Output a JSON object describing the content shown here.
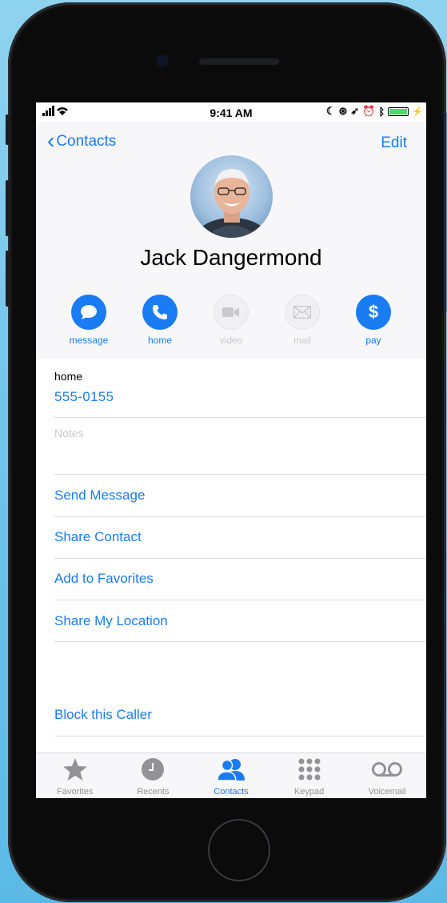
{
  "status_bar": {
    "time": "9:41 AM"
  },
  "nav": {
    "back_label": "Contacts",
    "edit_label": "Edit"
  },
  "contact": {
    "name": "Jack Dangermond"
  },
  "actions": [
    {
      "label": "message",
      "icon": "message-bubble-icon",
      "enabled": true
    },
    {
      "label": "home",
      "icon": "phone-icon",
      "enabled": true
    },
    {
      "label": "video",
      "icon": "video-camera-icon",
      "enabled": false
    },
    {
      "label": "mail",
      "icon": "envelope-icon",
      "enabled": false
    },
    {
      "label": "pay",
      "icon": "dollar-icon",
      "enabled": true
    }
  ],
  "phone": {
    "label": "home",
    "number": "555-0155"
  },
  "notes": {
    "placeholder": "Notes"
  },
  "links": {
    "send_message": "Send Message",
    "share_contact": "Share Contact",
    "add_to_favorites": "Add to Favorites",
    "share_location": "Share My Location",
    "block_caller": "Block this Caller"
  },
  "tabs": [
    {
      "label": "Favorites",
      "icon": "star-icon",
      "active": false
    },
    {
      "label": "Recents",
      "icon": "clock-icon",
      "active": false
    },
    {
      "label": "Contacts",
      "icon": "contacts-icon",
      "active": true
    },
    {
      "label": "Keypad",
      "icon": "keypad-icon",
      "active": false
    },
    {
      "label": "Voicemail",
      "icon": "voicemail-icon",
      "active": false
    }
  ],
  "colors": {
    "accent": "#1a7cf3",
    "background": "#6fc4ea",
    "triangle": "#1a9fc8"
  }
}
